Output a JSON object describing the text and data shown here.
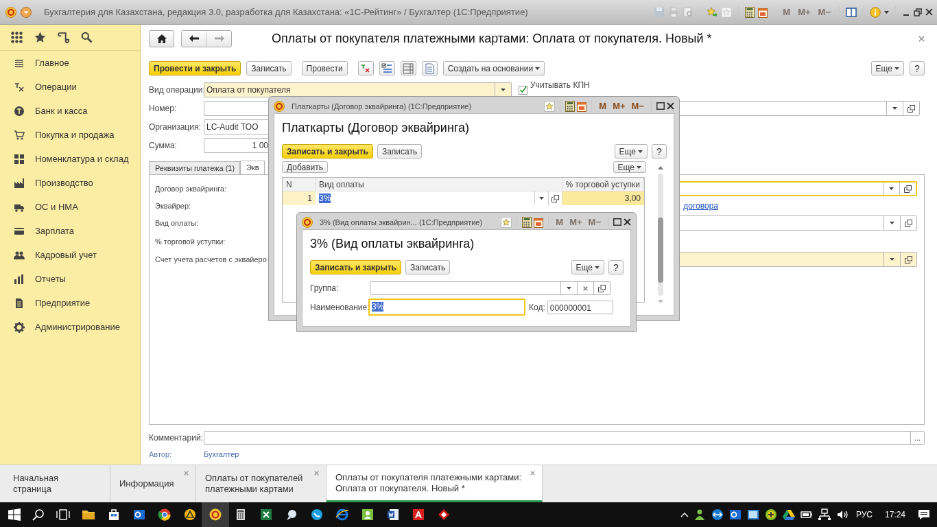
{
  "window": {
    "title": "Бухгалтерия для Казахстана, редакция 3.0, разработка для Казахстана: «1С-Рейтинг» / Бухгалтер  (1С:Предприятие)",
    "memory_buttons": [
      "M",
      "M+",
      "M−"
    ],
    "memory_enabled": false
  },
  "sidebar": {
    "items": [
      {
        "label": "Главное"
      },
      {
        "label": "Операции"
      },
      {
        "label": "Банк и касса"
      },
      {
        "label": "Покупка и продажа"
      },
      {
        "label": "Номенклатура и склад"
      },
      {
        "label": "Производство"
      },
      {
        "label": "ОС и НМА"
      },
      {
        "label": "Зарплата"
      },
      {
        "label": "Кадровый учет"
      },
      {
        "label": "Отчеты"
      },
      {
        "label": "Предприятие"
      },
      {
        "label": "Администрирование"
      }
    ]
  },
  "form": {
    "title": "Оплаты от покупателя платежными картами: Оплата от покупателя. Новый *",
    "toolbar": [
      {
        "kind": "primary",
        "label": "Провести и закрыть"
      },
      {
        "kind": "button",
        "label": "Записать"
      },
      {
        "kind": "button",
        "label": "Провести"
      },
      {
        "kind": "icon"
      },
      {
        "kind": "icon"
      },
      {
        "kind": "icon"
      },
      {
        "kind": "icon"
      },
      {
        "kind": "menu",
        "label": "Создать на основании"
      }
    ],
    "more": "Еще",
    "help": "?",
    "fields": [
      {
        "label": "Вид операции:",
        "value": "Оплата от покупателя",
        "kind": "select",
        "highlighted": true
      },
      {
        "label": "Номер:",
        "kind": "reference",
        "highlighted": false
      },
      {
        "label": "Организация:",
        "value": "LC-Audit ТОО",
        "kind": "text",
        "highlighted": false
      },
      {
        "label": "Сумма:",
        "value": "1 00",
        "kind": "number",
        "highlighted": false
      }
    ],
    "checkbox": {
      "label": "Учитывать КПН",
      "checked": true
    },
    "tabs": [
      {
        "label": "Реквизиты платежа (1)",
        "selected": false
      },
      {
        "label": "Экв",
        "selected": true
      }
    ],
    "panel_fields": [
      {
        "label": "Договор эквайринга:",
        "kind": "reference",
        "focused": true,
        "highlighted": false
      },
      {
        "label": "Эквайрер:",
        "kind": "link",
        "link": "договора",
        "focused": false,
        "highlighted": false
      },
      {
        "label": "Вид оплаты:",
        "kind": "reference",
        "focused": false,
        "highlighted": false
      },
      {
        "label": "% торговой уступки:",
        "kind": "empty",
        "focused": false,
        "highlighted": false
      },
      {
        "label": "Счет учета расчетов с эквайеро",
        "kind": "reference",
        "focused": false,
        "highlighted": true
      }
    ],
    "comment": {
      "label": "Комментарий:",
      "button": "..."
    },
    "author": {
      "label": "Автор:",
      "value": "Бухгалтер"
    }
  },
  "dialogs": [
    {
      "title": "Платкарты (Договор эквайринга)  (1С:Предприятие)",
      "memory_buttons": [
        "M",
        "M+",
        "M−"
      ],
      "memory_enabled": true,
      "heading": "Платкарты (Договор эквайринга)",
      "save_close": "Записать и закрыть",
      "save": "Записать",
      "more": "Еще",
      "help": "?",
      "list_buttons": [
        "Добавить",
        "Еще"
      ],
      "table": {
        "columns": [
          "N",
          "Вид оплаты",
          "%  торговой уступки"
        ],
        "rows": [
          {
            "cells": [
              "1",
              "3%",
              "3,00"
            ],
            "selected": true
          }
        ]
      }
    },
    {
      "title": "3% (Вид оплаты эквайрин...  (1С:Предприятие)",
      "memory_buttons": [
        "M",
        "M+",
        "M−"
      ],
      "memory_enabled": false,
      "heading": "3% (Вид оплаты эквайринга)",
      "save_close": "Записать и закрыть",
      "save": "Записать",
      "more": "Еще",
      "help": "?",
      "fields": [
        {
          "label": "Группа:",
          "kind": "clearable_reference",
          "focused": false
        },
        {
          "label": "Наименование:",
          "value": "3%",
          "kind": "text",
          "focused": true
        },
        {
          "label": "Код:",
          "value": "000000001",
          "kind": "text",
          "focused": false
        }
      ]
    }
  ],
  "open_tabs": [
    {
      "label": "Начальная страница",
      "selected": false,
      "closable": false
    },
    {
      "label": "Информация",
      "selected": false,
      "closable": true
    },
    {
      "label": "Оплаты от покупателей платежными картами",
      "selected": false,
      "closable": true
    },
    {
      "label": "Оплаты от покупателя платежными картами: Оплата от покупателя. Новый *",
      "selected": true,
      "closable": true
    }
  ],
  "taskbar": {
    "language": "РУС",
    "time": "17:24"
  }
}
